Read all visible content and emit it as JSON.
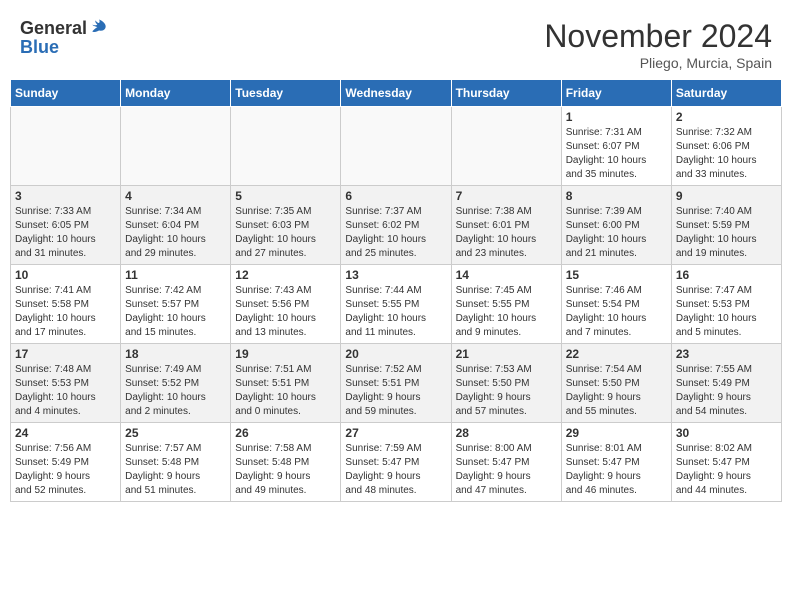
{
  "header": {
    "logo_general": "General",
    "logo_blue": "Blue",
    "month_title": "November 2024",
    "location": "Pliego, Murcia, Spain"
  },
  "weekdays": [
    "Sunday",
    "Monday",
    "Tuesday",
    "Wednesday",
    "Thursday",
    "Friday",
    "Saturday"
  ],
  "weeks": [
    [
      {
        "day": "",
        "info": ""
      },
      {
        "day": "",
        "info": ""
      },
      {
        "day": "",
        "info": ""
      },
      {
        "day": "",
        "info": ""
      },
      {
        "day": "",
        "info": ""
      },
      {
        "day": "1",
        "info": "Sunrise: 7:31 AM\nSunset: 6:07 PM\nDaylight: 10 hours\nand 35 minutes."
      },
      {
        "day": "2",
        "info": "Sunrise: 7:32 AM\nSunset: 6:06 PM\nDaylight: 10 hours\nand 33 minutes."
      }
    ],
    [
      {
        "day": "3",
        "info": "Sunrise: 7:33 AM\nSunset: 6:05 PM\nDaylight: 10 hours\nand 31 minutes."
      },
      {
        "day": "4",
        "info": "Sunrise: 7:34 AM\nSunset: 6:04 PM\nDaylight: 10 hours\nand 29 minutes."
      },
      {
        "day": "5",
        "info": "Sunrise: 7:35 AM\nSunset: 6:03 PM\nDaylight: 10 hours\nand 27 minutes."
      },
      {
        "day": "6",
        "info": "Sunrise: 7:37 AM\nSunset: 6:02 PM\nDaylight: 10 hours\nand 25 minutes."
      },
      {
        "day": "7",
        "info": "Sunrise: 7:38 AM\nSunset: 6:01 PM\nDaylight: 10 hours\nand 23 minutes."
      },
      {
        "day": "8",
        "info": "Sunrise: 7:39 AM\nSunset: 6:00 PM\nDaylight: 10 hours\nand 21 minutes."
      },
      {
        "day": "9",
        "info": "Sunrise: 7:40 AM\nSunset: 5:59 PM\nDaylight: 10 hours\nand 19 minutes."
      }
    ],
    [
      {
        "day": "10",
        "info": "Sunrise: 7:41 AM\nSunset: 5:58 PM\nDaylight: 10 hours\nand 17 minutes."
      },
      {
        "day": "11",
        "info": "Sunrise: 7:42 AM\nSunset: 5:57 PM\nDaylight: 10 hours\nand 15 minutes."
      },
      {
        "day": "12",
        "info": "Sunrise: 7:43 AM\nSunset: 5:56 PM\nDaylight: 10 hours\nand 13 minutes."
      },
      {
        "day": "13",
        "info": "Sunrise: 7:44 AM\nSunset: 5:55 PM\nDaylight: 10 hours\nand 11 minutes."
      },
      {
        "day": "14",
        "info": "Sunrise: 7:45 AM\nSunset: 5:55 PM\nDaylight: 10 hours\nand 9 minutes."
      },
      {
        "day": "15",
        "info": "Sunrise: 7:46 AM\nSunset: 5:54 PM\nDaylight: 10 hours\nand 7 minutes."
      },
      {
        "day": "16",
        "info": "Sunrise: 7:47 AM\nSunset: 5:53 PM\nDaylight: 10 hours\nand 5 minutes."
      }
    ],
    [
      {
        "day": "17",
        "info": "Sunrise: 7:48 AM\nSunset: 5:53 PM\nDaylight: 10 hours\nand 4 minutes."
      },
      {
        "day": "18",
        "info": "Sunrise: 7:49 AM\nSunset: 5:52 PM\nDaylight: 10 hours\nand 2 minutes."
      },
      {
        "day": "19",
        "info": "Sunrise: 7:51 AM\nSunset: 5:51 PM\nDaylight: 10 hours\nand 0 minutes."
      },
      {
        "day": "20",
        "info": "Sunrise: 7:52 AM\nSunset: 5:51 PM\nDaylight: 9 hours\nand 59 minutes."
      },
      {
        "day": "21",
        "info": "Sunrise: 7:53 AM\nSunset: 5:50 PM\nDaylight: 9 hours\nand 57 minutes."
      },
      {
        "day": "22",
        "info": "Sunrise: 7:54 AM\nSunset: 5:50 PM\nDaylight: 9 hours\nand 55 minutes."
      },
      {
        "day": "23",
        "info": "Sunrise: 7:55 AM\nSunset: 5:49 PM\nDaylight: 9 hours\nand 54 minutes."
      }
    ],
    [
      {
        "day": "24",
        "info": "Sunrise: 7:56 AM\nSunset: 5:49 PM\nDaylight: 9 hours\nand 52 minutes."
      },
      {
        "day": "25",
        "info": "Sunrise: 7:57 AM\nSunset: 5:48 PM\nDaylight: 9 hours\nand 51 minutes."
      },
      {
        "day": "26",
        "info": "Sunrise: 7:58 AM\nSunset: 5:48 PM\nDaylight: 9 hours\nand 49 minutes."
      },
      {
        "day": "27",
        "info": "Sunrise: 7:59 AM\nSunset: 5:47 PM\nDaylight: 9 hours\nand 48 minutes."
      },
      {
        "day": "28",
        "info": "Sunrise: 8:00 AM\nSunset: 5:47 PM\nDaylight: 9 hours\nand 47 minutes."
      },
      {
        "day": "29",
        "info": "Sunrise: 8:01 AM\nSunset: 5:47 PM\nDaylight: 9 hours\nand 46 minutes."
      },
      {
        "day": "30",
        "info": "Sunrise: 8:02 AM\nSunset: 5:47 PM\nDaylight: 9 hours\nand 44 minutes."
      }
    ]
  ]
}
